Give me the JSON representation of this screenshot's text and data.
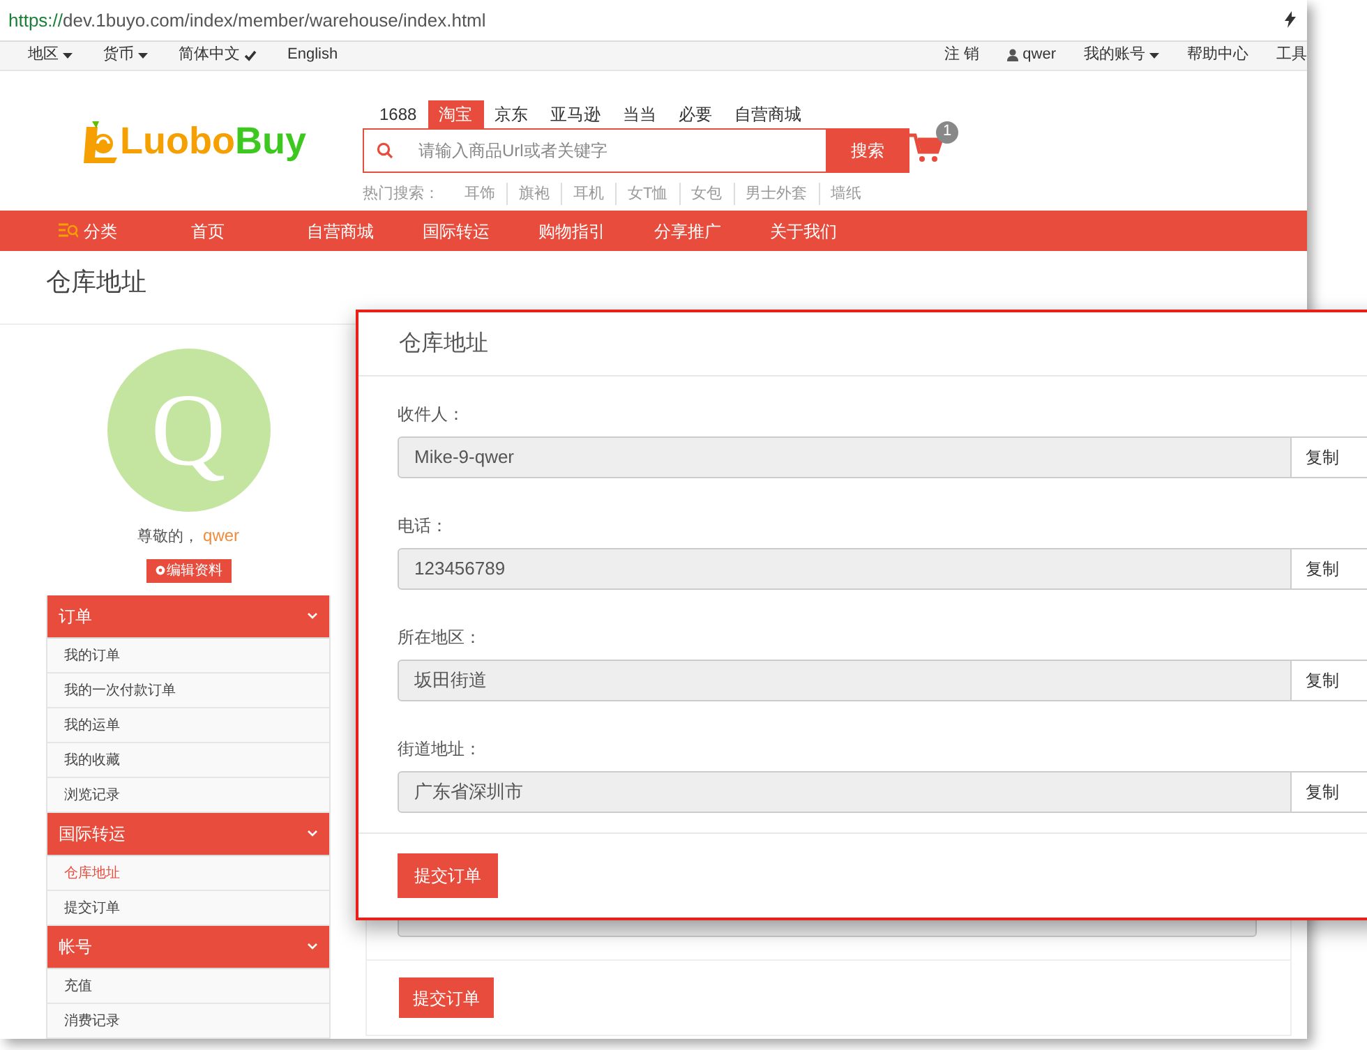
{
  "browser": {
    "url_scheme": "https://",
    "url_rest": "dev.1buyo.com/index/member/warehouse/index.html"
  },
  "top_bar": {
    "left": [
      {
        "label": "地区",
        "kind": "dropdown"
      },
      {
        "label": "货币",
        "kind": "dropdown"
      },
      {
        "label": "简体中文",
        "kind": "checked"
      },
      {
        "label": "English",
        "kind": "plain"
      }
    ],
    "right": [
      {
        "label": "注 销",
        "kind": "plain"
      },
      {
        "label": "qwer",
        "kind": "user"
      },
      {
        "label": "我的账号",
        "kind": "dropdown"
      },
      {
        "label": "帮助中心",
        "kind": "plain"
      },
      {
        "label": "工具",
        "kind": "plain"
      }
    ]
  },
  "logo": {
    "first": "Luobo",
    "second": "Buy"
  },
  "search": {
    "tabs": [
      {
        "label": "1688",
        "selected": false
      },
      {
        "label": "淘宝",
        "selected": true
      },
      {
        "label": "京东",
        "selected": false
      },
      {
        "label": "亚马逊",
        "selected": false
      },
      {
        "label": "当当",
        "selected": false
      },
      {
        "label": "必要",
        "selected": false
      },
      {
        "label": "自营商城",
        "selected": false
      }
    ],
    "placeholder": "请输入商品Url或者关键字",
    "button": "搜索",
    "hot_label": "热门搜索：",
    "hot": [
      "耳饰",
      "旗袍",
      "耳机",
      "女T恤",
      "女包",
      "男士外套",
      "墙纸"
    ]
  },
  "cart": {
    "count": "1"
  },
  "nav": [
    {
      "label": "分类",
      "kind": "category"
    },
    {
      "label": "首页",
      "kind": "link"
    },
    {
      "label": "自营商城",
      "kind": "link"
    },
    {
      "label": "国际转运",
      "kind": "link"
    },
    {
      "label": "购物指引",
      "kind": "link"
    },
    {
      "label": "分享推广",
      "kind": "link"
    },
    {
      "label": "关于我们",
      "kind": "link"
    }
  ],
  "page_title": "仓库地址",
  "profile": {
    "avatar_letter": "Q",
    "greeting": "尊敬的，",
    "username": "qwer",
    "edit_button": "编辑资料"
  },
  "menu": [
    {
      "title": "订单",
      "expanded": true,
      "items": [
        {
          "label": "我的订单",
          "selected": false
        },
        {
          "label": "我的一次付款订单",
          "selected": false
        },
        {
          "label": "我的运单",
          "selected": false
        },
        {
          "label": "我的收藏",
          "selected": false
        },
        {
          "label": "浏览记录",
          "selected": false
        }
      ]
    },
    {
      "title": "国际转运",
      "expanded": true,
      "items": [
        {
          "label": "仓库地址",
          "selected": true
        },
        {
          "label": "提交订单",
          "selected": false
        }
      ]
    },
    {
      "title": "帐号",
      "expanded": true,
      "items": [
        {
          "label": "充值",
          "selected": false
        },
        {
          "label": "消费记录",
          "selected": false
        }
      ]
    }
  ],
  "content": {
    "submit_button": "提交订单"
  },
  "popup": {
    "title": "仓库地址",
    "fields": [
      {
        "label": "收件人：",
        "value": "Mike-9-qwer",
        "copy": "复制"
      },
      {
        "label": "电话：",
        "value": "123456789",
        "copy": "复制"
      },
      {
        "label": "所在地区：",
        "value": "坂田街道",
        "copy": "复制"
      },
      {
        "label": "街道地址：",
        "value": "广东省深圳市",
        "copy": "复制"
      }
    ],
    "submit_button": "提交订单"
  }
}
